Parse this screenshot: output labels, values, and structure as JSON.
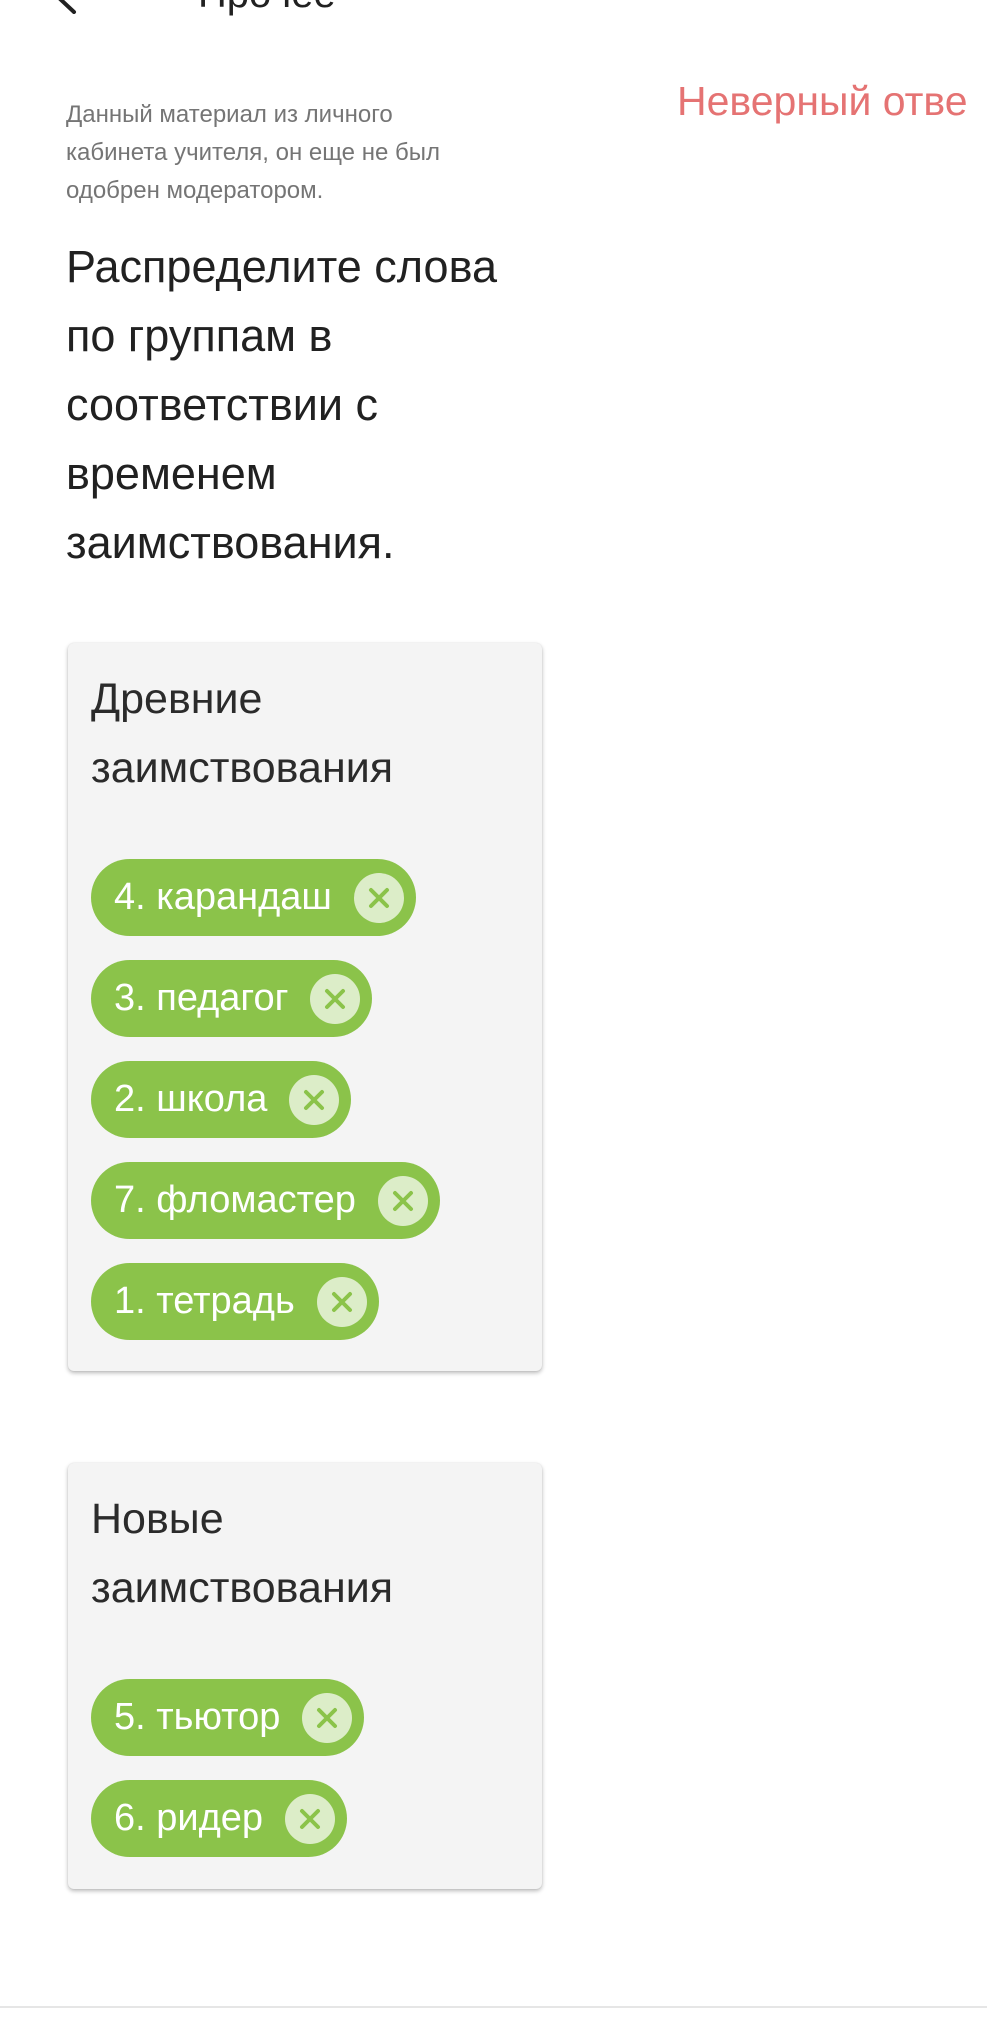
{
  "header": {
    "title": "Прочее",
    "back_icon": "arrow-left-icon"
  },
  "status": {
    "wrong_answer": "Неверный отве",
    "color": "#e57373"
  },
  "note": "Данный материал из личного кабинета учителя, он еще не был одобрен модератором.",
  "question": "Распределите слова по группам в соответствии с временем заимствования.",
  "colors": {
    "chip": "#8bc34a",
    "chip_remove_bg": "#dcedc8",
    "group_bg": "#f4f4f4"
  },
  "groups": [
    {
      "title": "Древние заимствования",
      "chips": [
        {
          "label": "4. карандаш",
          "remove_icon": "close-icon"
        },
        {
          "label": "3. педагог",
          "remove_icon": "close-icon"
        },
        {
          "label": "2. школа",
          "remove_icon": "close-icon"
        },
        {
          "label": "7. фломастер",
          "remove_icon": "close-icon"
        },
        {
          "label": "1. тетрадь",
          "remove_icon": "close-icon"
        }
      ]
    },
    {
      "title": "Новые заимствования",
      "chips": [
        {
          "label": "5. тьютор",
          "remove_icon": "close-icon"
        },
        {
          "label": "6. ридер",
          "remove_icon": "close-icon"
        }
      ]
    }
  ]
}
